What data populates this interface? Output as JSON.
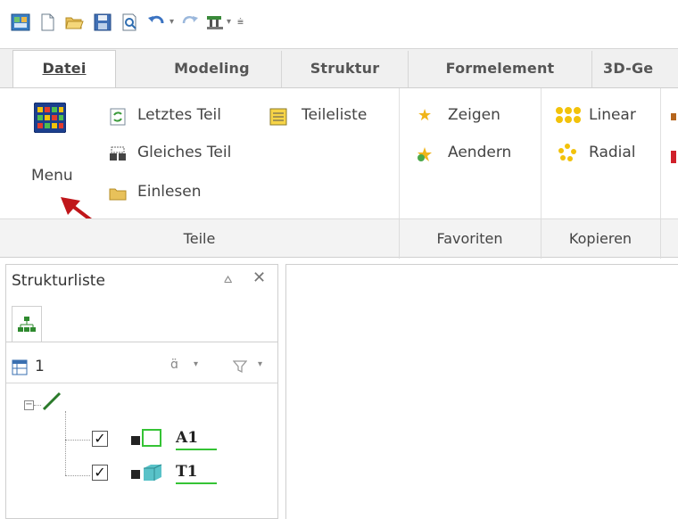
{
  "quick_access": {
    "icons": [
      "app-icon",
      "new-file-icon",
      "open-folder-icon",
      "save-icon",
      "print-preview-icon",
      "undo-icon",
      "redo-icon",
      "model-tool-icon"
    ]
  },
  "tabs": [
    {
      "label": "Datei"
    },
    {
      "label": "Modeling"
    },
    {
      "label": "Struktur"
    },
    {
      "label": "Formelement"
    },
    {
      "label": "3D-Ge"
    }
  ],
  "ribbon": {
    "menu_label": "Menu",
    "teile_items": [
      "Letztes Teil",
      "Gleiches Teil",
      "Einlesen",
      "Teileliste"
    ],
    "favoriten_items": [
      "Zeigen",
      "Aendern"
    ],
    "kopieren_items": [
      "Linear",
      "Radial"
    ],
    "groups": [
      "Teile",
      "Favoriten",
      "Kopieren"
    ]
  },
  "structure_panel": {
    "title": "Strukturliste",
    "pin_glyph": "⩟",
    "close_glyph": "✕",
    "count": "1",
    "tree": [
      {
        "label": "A1",
        "checked": true
      },
      {
        "label": "T1",
        "checked": true
      }
    ]
  }
}
